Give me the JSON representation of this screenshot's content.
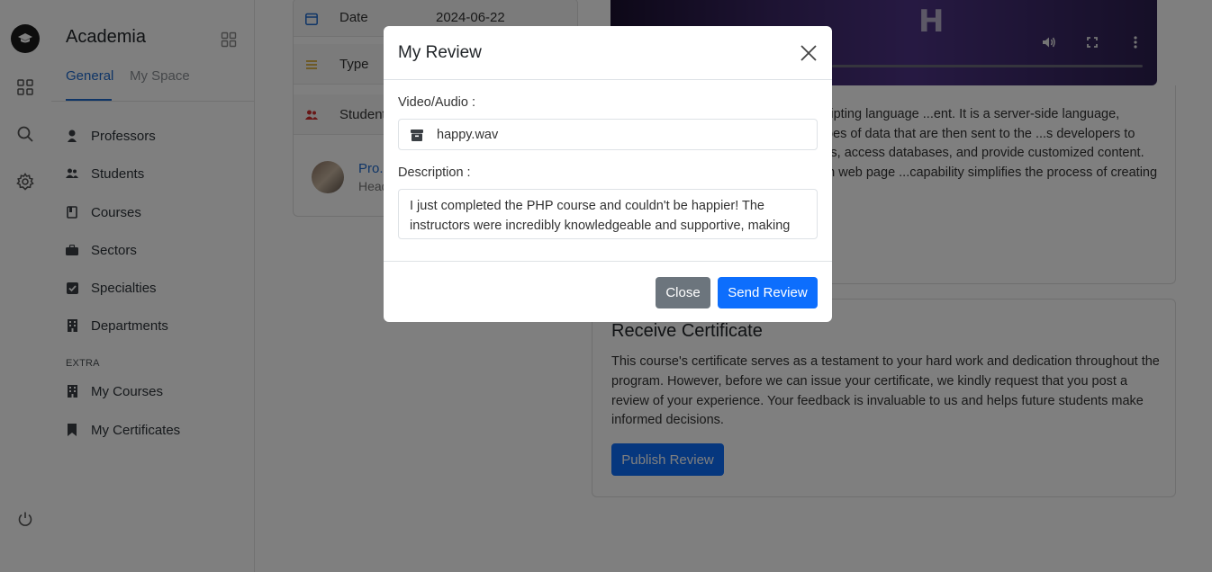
{
  "app": {
    "brand": "Academia"
  },
  "sidebar": {
    "tabs": [
      {
        "label": "General"
      },
      {
        "label": "My Space"
      }
    ],
    "items": [
      {
        "label": "Professors"
      },
      {
        "label": "Students"
      },
      {
        "label": "Courses"
      },
      {
        "label": "Sectors"
      },
      {
        "label": "Specialties"
      },
      {
        "label": "Departments"
      }
    ],
    "extra_label": "EXTRA",
    "extra_items": [
      {
        "label": "My Courses"
      },
      {
        "label": "My Certificates"
      }
    ]
  },
  "course_info": {
    "rows": [
      {
        "label": "Date",
        "value": "2024-06-22"
      },
      {
        "label": "Type",
        "value": ""
      },
      {
        "label": "Students",
        "value": ""
      }
    ],
    "professor": {
      "name": "Pro...",
      "subtitle": "Head..."
    }
  },
  "about": {
    "text": "...rsatile, widely-used open-source scripting language ...ent. It is a server-side language, meaning its code is ...TML or other types of data that are then sent to the ...s developers to create dynamic and interactive web ...s, access databases, and provide customized content. ...TML, making it easy to integrate with web page ...capability simplifies the process of creating dynamic ...scripting."
  },
  "certificate": {
    "title": "Receive Certificate",
    "text": "This course's certificate serves as a testament to your hard work and dedication throughout the program. However, before we can issue your certificate, we kindly request that you post a review of your experience. Your feedback is invaluable to us and helps future students make informed decisions.",
    "button": "Publish Review"
  },
  "modal": {
    "title": "My Review",
    "media_label": "Video/Audio :",
    "file_name": "happy.wav",
    "description_label": "Description :",
    "description": "I just completed the PHP course and couldn't be happier! The instructors were incredibly knowledgeable and supportive, making the course engaging and easy to understand. The hands-on projects and",
    "close_button": "Close",
    "send_button": "Send Review"
  },
  "colors": {
    "accent": "#0d6efd",
    "brand_blue": "#1f6bcf",
    "secondary_button": "#6c757d",
    "backdrop": "rgba(0,0,0,0.5)"
  },
  "icons": {
    "logo": "graduation-cap-icon",
    "rail": [
      "dashboard-grid-icon",
      "search-icon",
      "gear-icon",
      "power-icon"
    ],
    "file": "archive-box-icon",
    "close": "close-icon"
  }
}
